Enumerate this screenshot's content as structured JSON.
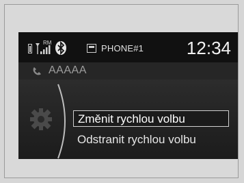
{
  "status_bar": {
    "roaming_label": "RM",
    "phone_name": "PHONE#1",
    "clock": "12:34"
  },
  "call": {
    "contact_name": "AAAAA"
  },
  "menu": {
    "items": [
      {
        "label": "Změnit rychlou volbu",
        "selected": true
      },
      {
        "label": "Odstranit rychlou volbu",
        "selected": false
      }
    ]
  },
  "icons": [
    "battery-icon",
    "signal-icon",
    "bluetooth-icon",
    "phone-icon",
    "handset-icon",
    "gear-icon"
  ],
  "colors": {
    "screen_bg": "#2a2a2a",
    "highlight_border": "#d0d0d0"
  }
}
